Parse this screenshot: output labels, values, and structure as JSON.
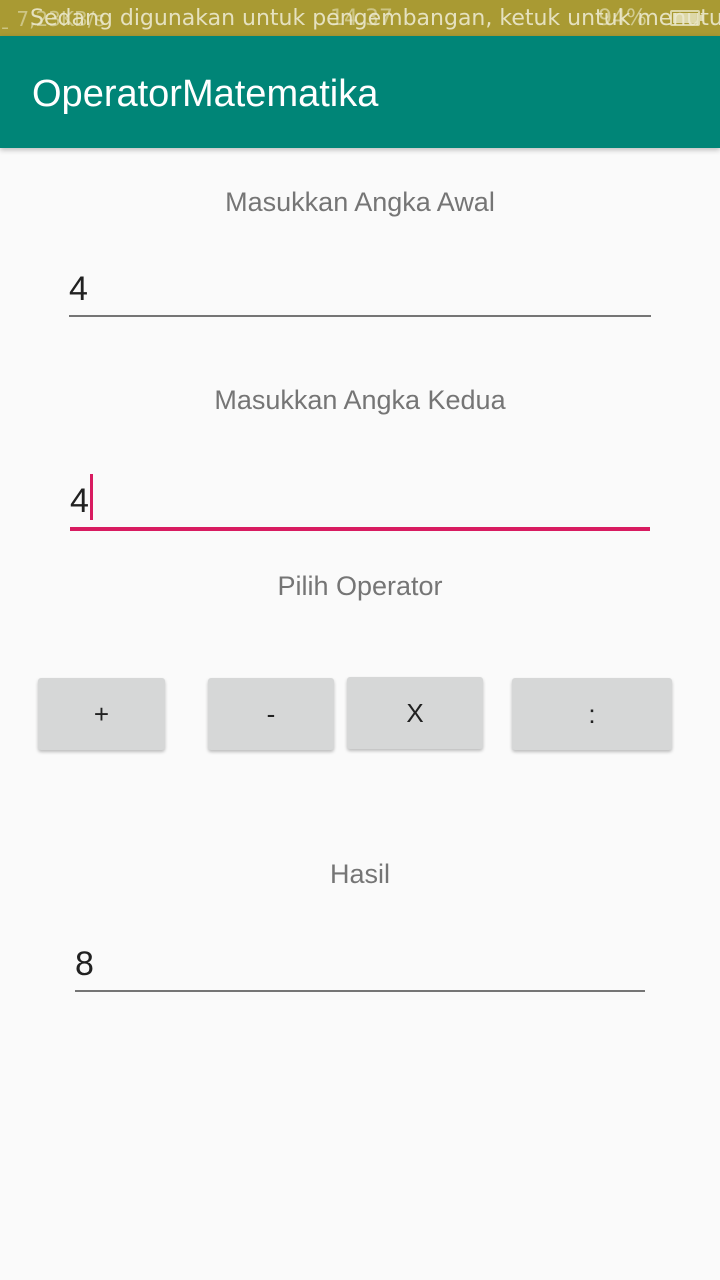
{
  "status_bar": {
    "left_text": "̱ 7,23KB/s",
    "notice": "Sedang digunakan untuk pengembangan, ketuk untuk menutup",
    "time": "14.37",
    "battery": "94%",
    "battery_level_percent": 94,
    "icons": [
      "signal-icon",
      "mail-icon",
      "chart-icon",
      "chat-icon",
      "image-icon",
      "alarm-icon",
      "battery-icon"
    ]
  },
  "app_bar": {
    "title": "OperatorMatematika",
    "color": "#008577"
  },
  "form": {
    "first_label": "Masukkan Angka Awal",
    "first_value": "4",
    "second_label": "Masukkan Angka Kedua",
    "second_value": "4",
    "operator_label": "Pilih Operator",
    "buttons": {
      "add": "+",
      "subtract": "-",
      "multiply": "X",
      "divide": ":"
    },
    "result_label": "Hasil",
    "result_value": "8"
  },
  "colors": {
    "accent": "#d81b60",
    "status_bar": "#a99a33",
    "background": "#fafafa"
  }
}
